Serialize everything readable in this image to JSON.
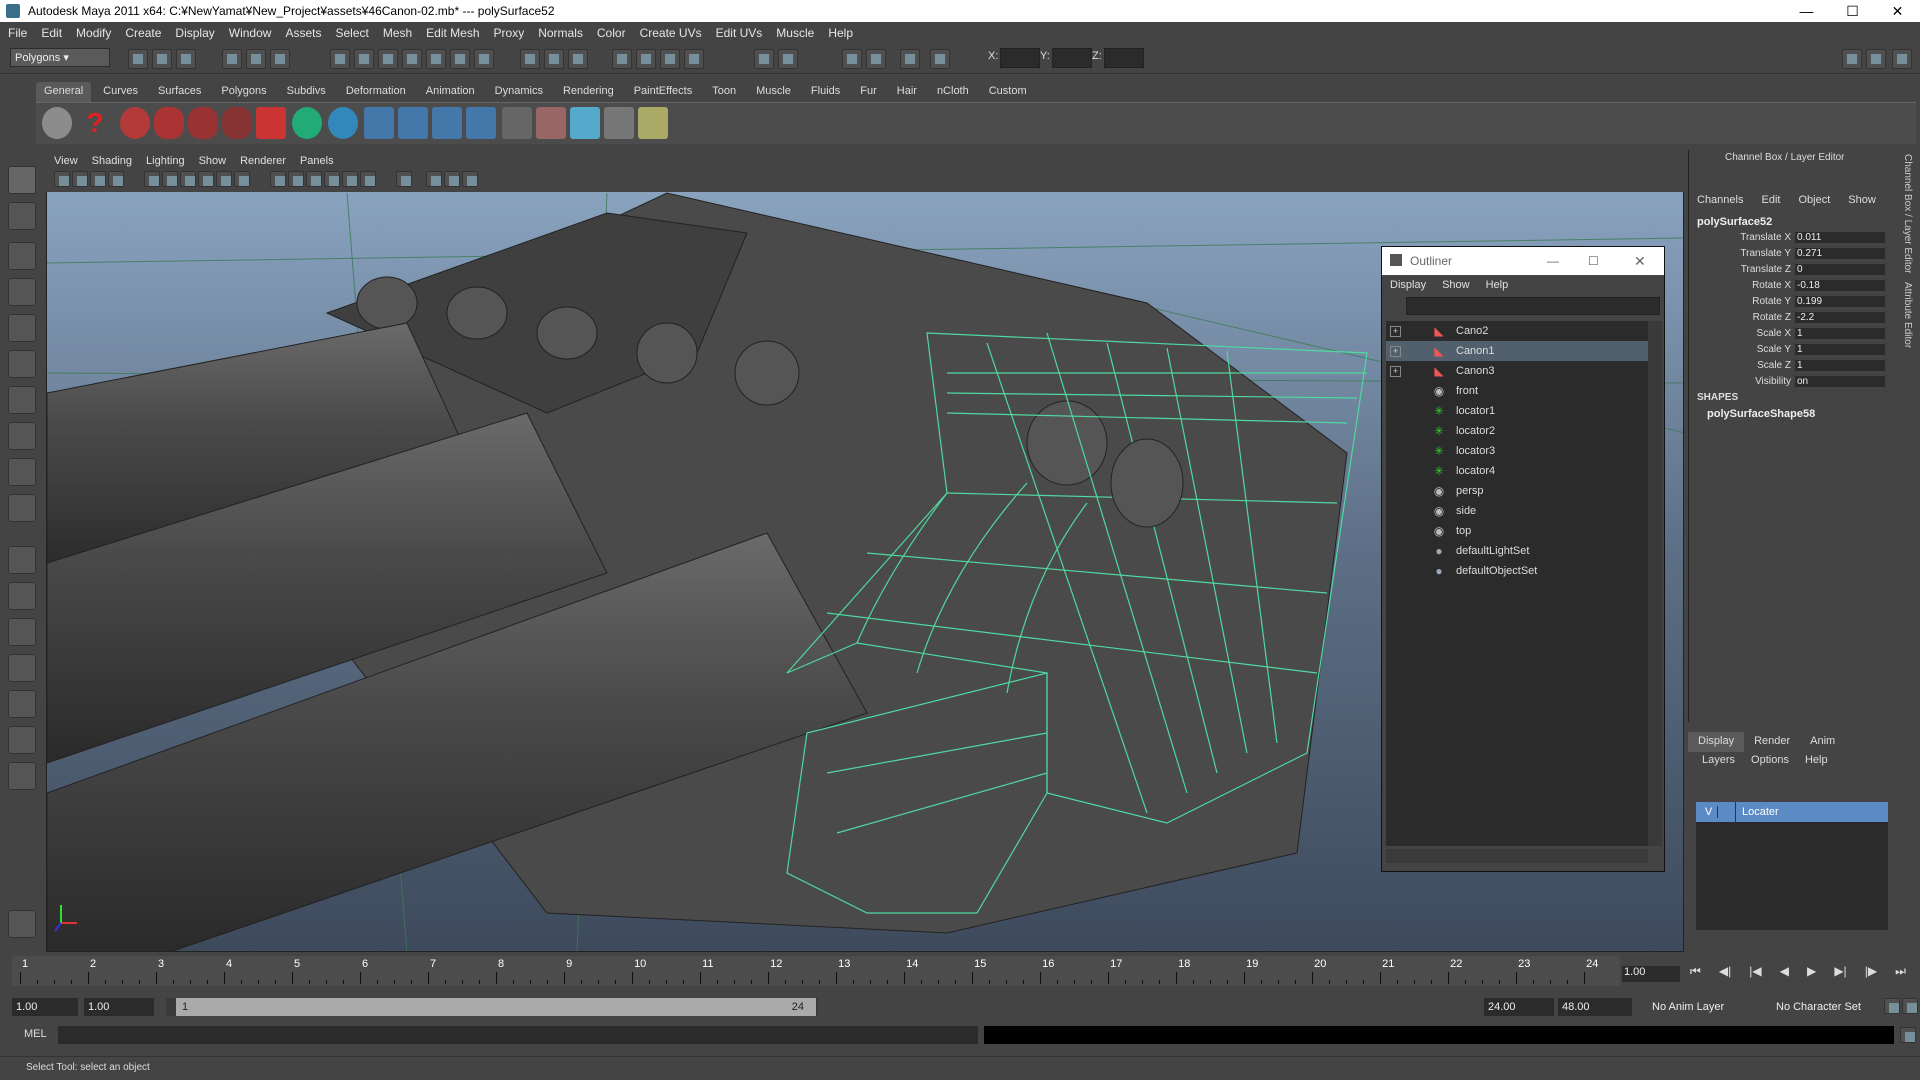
{
  "window": {
    "title": "Autodesk Maya 2011 x64: C:¥NewYamat¥New_Project¥assets¥46Canon-02.mb*  ---  polySurface52"
  },
  "menubar": [
    "File",
    "Edit",
    "Modify",
    "Create",
    "Display",
    "Window",
    "Assets",
    "Select",
    "Mesh",
    "Edit Mesh",
    "Proxy",
    "Normals",
    "Color",
    "Create UVs",
    "Edit UVs",
    "Muscle",
    "Help"
  ],
  "statusline": {
    "mode": "Polygons",
    "x_label": "X:",
    "y_label": "Y:",
    "z_label": "Z:"
  },
  "shelf": {
    "tabs": [
      "General",
      "Curves",
      "Surfaces",
      "Polygons",
      "Subdivs",
      "Deformation",
      "Animation",
      "Dynamics",
      "Rendering",
      "PaintEffects",
      "Toon",
      "Muscle",
      "Fluids",
      "Fur",
      "Hair",
      "nCloth",
      "Custom"
    ],
    "active": "General"
  },
  "viewport": {
    "menu": [
      "View",
      "Shading",
      "Lighting",
      "Show",
      "Renderer",
      "Panels"
    ],
    "camera": "persp"
  },
  "outliner": {
    "title": "Outliner",
    "menu": [
      "Display",
      "Show",
      "Help"
    ],
    "items": [
      {
        "name": "Cano2",
        "type": "mesh",
        "expandable": true,
        "selected": false
      },
      {
        "name": "Canon1",
        "type": "mesh",
        "expandable": true,
        "selected": true
      },
      {
        "name": "Canon3",
        "type": "mesh",
        "expandable": true,
        "selected": false
      },
      {
        "name": "front",
        "type": "camera",
        "expandable": false,
        "selected": false
      },
      {
        "name": "locator1",
        "type": "locator",
        "expandable": false,
        "selected": false
      },
      {
        "name": "locator2",
        "type": "locator",
        "expandable": false,
        "selected": false
      },
      {
        "name": "locator3",
        "type": "locator",
        "expandable": false,
        "selected": false
      },
      {
        "name": "locator4",
        "type": "locator",
        "expandable": false,
        "selected": false
      },
      {
        "name": "persp",
        "type": "camera",
        "expandable": false,
        "selected": false
      },
      {
        "name": "side",
        "type": "camera",
        "expandable": false,
        "selected": false
      },
      {
        "name": "top",
        "type": "camera",
        "expandable": false,
        "selected": false
      },
      {
        "name": "defaultLightSet",
        "type": "set",
        "expandable": false,
        "selected": false
      },
      {
        "name": "defaultObjectSet",
        "type": "set",
        "expandable": false,
        "selected": false
      }
    ]
  },
  "channelbox": {
    "title": "Channel Box / Layer Editor",
    "menu": [
      "Channels",
      "Edit",
      "Object",
      "Show"
    ],
    "object": "polySurface52",
    "attributes": [
      {
        "name": "Translate X",
        "value": "0.011"
      },
      {
        "name": "Translate Y",
        "value": "0.271"
      },
      {
        "name": "Translate Z",
        "value": "0"
      },
      {
        "name": "Rotate X",
        "value": "-0.18"
      },
      {
        "name": "Rotate Y",
        "value": "0.199"
      },
      {
        "name": "Rotate Z",
        "value": "-2.2"
      },
      {
        "name": "Scale X",
        "value": "1"
      },
      {
        "name": "Scale Y",
        "value": "1"
      },
      {
        "name": "Scale Z",
        "value": "1"
      },
      {
        "name": "Visibility",
        "value": "on"
      }
    ],
    "shapes_label": "SHAPES",
    "shape": "polySurfaceShape58"
  },
  "layereditor": {
    "tabs": [
      "Display",
      "Render",
      "Anim"
    ],
    "active": "Display",
    "menu": [
      "Layers",
      "Options",
      "Help"
    ],
    "layer": {
      "visible": "V",
      "name": "Locater"
    }
  },
  "sidetabs": [
    "Channel Box / Layer Editor",
    "Attribute Editor"
  ],
  "timeline": {
    "ticks": [
      "1",
      "2",
      "3",
      "4",
      "5",
      "6",
      "7",
      "8",
      "9",
      "10",
      "11",
      "12",
      "13",
      "14",
      "15",
      "16",
      "17",
      "18",
      "19",
      "20",
      "21",
      "22",
      "23",
      "24"
    ],
    "current": "1.00"
  },
  "range": {
    "start": "1.00",
    "start_inner": "1.00",
    "slider_start": "1",
    "slider_end": "24",
    "end_inner": "24.00",
    "end": "48.00",
    "anim_layer": "No Anim Layer",
    "char_set": "No Character Set"
  },
  "cmdline": {
    "label": "MEL"
  },
  "helpline": "Select Tool: select an object"
}
